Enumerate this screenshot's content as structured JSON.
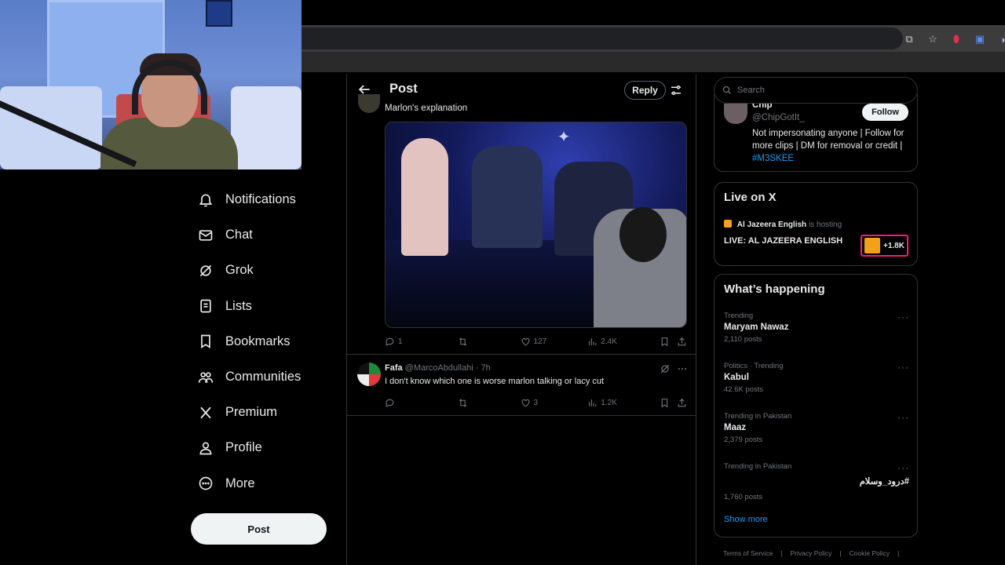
{
  "nav": {
    "items": [
      {
        "label": "Notifications",
        "icon": "bell-icon"
      },
      {
        "label": "Chat",
        "icon": "mail-icon"
      },
      {
        "label": "Grok",
        "icon": "grok-icon"
      },
      {
        "label": "Lists",
        "icon": "list-icon"
      },
      {
        "label": "Bookmarks",
        "icon": "bookmark-icon"
      },
      {
        "label": "Communities",
        "icon": "people-icon"
      },
      {
        "label": "Premium",
        "icon": "x-logo-icon"
      },
      {
        "label": "Profile",
        "icon": "person-icon"
      },
      {
        "label": "More",
        "icon": "more-circle-icon"
      }
    ],
    "post_button": "Post"
  },
  "thread": {
    "header_title": "Post",
    "reply_button": "Reply",
    "tweet1": {
      "text": "Marlon's explanation",
      "replies": "1",
      "reposts": "",
      "likes": "127",
      "views": "2.4K"
    },
    "tweet2": {
      "name": "Fafa",
      "handle": "@MarcoAbdullahi",
      "time": "· 7h",
      "text": "I don't know which one is worse marlon talking or lacy cut",
      "replies": "",
      "reposts": "",
      "likes": "3",
      "views": "1.2K"
    }
  },
  "sidebar": {
    "search_placeholder": "Search",
    "who_to_follow": {
      "name": "Chip",
      "handle": "@ChipGotIt_",
      "follow_label": "Follow",
      "bio": "Not impersonating anyone | Follow for more clips | DM for removal or credit |",
      "bio_tag": "#M3SKEE"
    },
    "live": {
      "title": "Live on X",
      "host_name": "Al Jazeera English",
      "host_suffix": "is hosting",
      "stream_title": "LIVE: AL JAZEERA ENGLISH",
      "listeners": "+1.8K"
    },
    "happening": {
      "title": "What’s happening",
      "trends": [
        {
          "meta": "Trending",
          "name": "Maryam Nawaz",
          "count": "2,110 posts"
        },
        {
          "meta": "Politics · Trending",
          "name": "Kabul",
          "count": "42.6K posts"
        },
        {
          "meta": "Trending in Pakistan",
          "name": "Maaz",
          "count": "2,379 posts"
        },
        {
          "meta": "Trending in Pakistan",
          "name": "#درود_وسلام",
          "count": "1,760 posts"
        }
      ],
      "show_more": "Show more"
    },
    "footer": [
      "Terms of Service",
      "|",
      "Privacy Policy",
      "|",
      "Cookie Policy",
      "|"
    ]
  },
  "colors": {
    "accent": "#1d9bf0",
    "background": "#000000",
    "border": "#2f3336",
    "live_highlight": "#f91880"
  }
}
